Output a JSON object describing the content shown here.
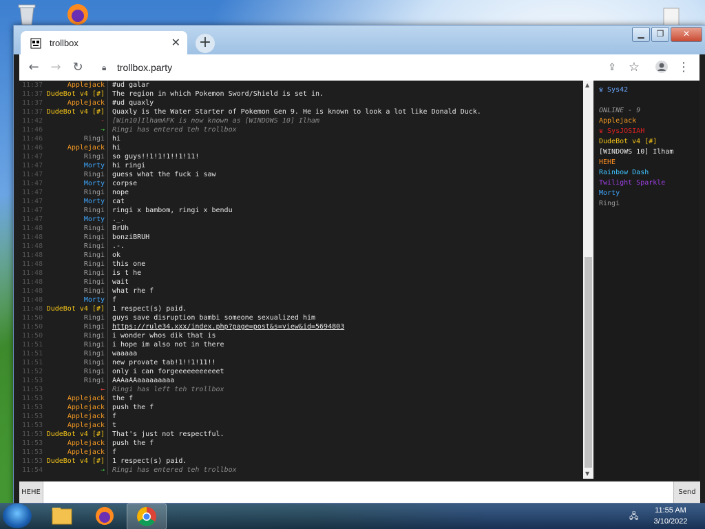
{
  "browser": {
    "tab_title": "trollbox",
    "url": "trollbox.party",
    "new_tab_label": "+",
    "close_tab_label": "✕"
  },
  "chat": {
    "messages": [
      {
        "time": "11:37",
        "nick": "Applejack",
        "color": "#f59a23",
        "text": "#ud galar"
      },
      {
        "time": "11:37",
        "nick": "DudeBot v4 [#]",
        "color": "#f5c518",
        "text": "The region in which Pokemon Sword/Shield is set in."
      },
      {
        "time": "11:37",
        "nick": "Applejack",
        "color": "#f59a23",
        "text": "#ud quaxly"
      },
      {
        "time": "11:37",
        "nick": "DudeBot v4 [#]",
        "color": "#f5c518",
        "text": "Quaxly is the Water Starter of Pokemon Gen 9. He is known to look a lot like Donald Duck."
      },
      {
        "time": "11:42",
        "nick": "-",
        "color": "#e04040",
        "text": "[Win10]IlhamAFK is now known as [WINDOWS 10] Ilham",
        "kind": "rename"
      },
      {
        "time": "11:46",
        "nick": "→",
        "color": "#3ccf3c",
        "text": "Ringi has entered teh trollbox",
        "kind": "sys"
      },
      {
        "time": "11:46",
        "nick": "Ringi",
        "color": "#9a9a9a",
        "text": "hi"
      },
      {
        "time": "11:46",
        "nick": "Applejack",
        "color": "#f59a23",
        "text": "hi"
      },
      {
        "time": "11:47",
        "nick": "Ringi",
        "color": "#9a9a9a",
        "text": "so guys!!1!1!1!!1!11!"
      },
      {
        "time": "11:47",
        "nick": "Morty",
        "color": "#3fa8ff",
        "text": "hi ringi"
      },
      {
        "time": "11:47",
        "nick": "Ringi",
        "color": "#9a9a9a",
        "text": "guess what the fuck i saw"
      },
      {
        "time": "11:47",
        "nick": "Morty",
        "color": "#3fa8ff",
        "text": "corpse"
      },
      {
        "time": "11:47",
        "nick": "Ringi",
        "color": "#9a9a9a",
        "text": "nope"
      },
      {
        "time": "11:47",
        "nick": "Morty",
        "color": "#3fa8ff",
        "text": "cat"
      },
      {
        "time": "11:47",
        "nick": "Ringi",
        "color": "#9a9a9a",
        "text": "ringi x bambom, ringi x bendu"
      },
      {
        "time": "11:47",
        "nick": "Morty",
        "color": "#3fa8ff",
        "text": "._."
      },
      {
        "time": "11:48",
        "nick": "Ringi",
        "color": "#9a9a9a",
        "text": "BrUh"
      },
      {
        "time": "11:48",
        "nick": "Ringi",
        "color": "#9a9a9a",
        "text": "bonziBRUH"
      },
      {
        "time": "11:48",
        "nick": "Ringi",
        "color": "#9a9a9a",
        "text": ".-."
      },
      {
        "time": "11:48",
        "nick": "Ringi",
        "color": "#9a9a9a",
        "text": "ok"
      },
      {
        "time": "11:48",
        "nick": "Ringi",
        "color": "#9a9a9a",
        "text": "this one"
      },
      {
        "time": "11:48",
        "nick": "Ringi",
        "color": "#9a9a9a",
        "text": "is t he"
      },
      {
        "time": "11:48",
        "nick": "Ringi",
        "color": "#9a9a9a",
        "text": "wait"
      },
      {
        "time": "11:48",
        "nick": "Ringi",
        "color": "#9a9a9a",
        "text": "what rhe f"
      },
      {
        "time": "11:48",
        "nick": "Morty",
        "color": "#3fa8ff",
        "text": "f"
      },
      {
        "time": "11:48",
        "nick": "DudeBot v4 [#]",
        "color": "#f5c518",
        "text": "1 respect(s) paid."
      },
      {
        "time": "11:50",
        "nick": "Ringi",
        "color": "#9a9a9a",
        "text": "guys save disruption bambi someone sexualized him"
      },
      {
        "time": "11:50",
        "nick": "Ringi",
        "color": "#9a9a9a",
        "text": "https://rule34.xxx/index.php?page=post&s=view&id=5694803",
        "kind": "link"
      },
      {
        "time": "11:50",
        "nick": "Ringi",
        "color": "#9a9a9a",
        "text": "i wonder whos dik that is"
      },
      {
        "time": "11:51",
        "nick": "Ringi",
        "color": "#9a9a9a",
        "text": "i hope im also not in there"
      },
      {
        "time": "11:51",
        "nick": "Ringi",
        "color": "#9a9a9a",
        "text": "waaaaa"
      },
      {
        "time": "11:51",
        "nick": "Ringi",
        "color": "#9a9a9a",
        "text": "new provate tab!1!!1!11!!"
      },
      {
        "time": "11:52",
        "nick": "Ringi",
        "color": "#9a9a9a",
        "text": "only i can forgeeeeeeeeeeet"
      },
      {
        "time": "11:53",
        "nick": "Ringi",
        "color": "#9a9a9a",
        "text": "AAAaAAaaaaaaaaa"
      },
      {
        "time": "11:53",
        "nick": "←",
        "color": "#e04040",
        "text": "Ringi has left teh trollbox",
        "kind": "sys"
      },
      {
        "time": "11:53",
        "nick": "Applejack",
        "color": "#f59a23",
        "text": "the f"
      },
      {
        "time": "11:53",
        "nick": "Applejack",
        "color": "#f59a23",
        "text": "push the f"
      },
      {
        "time": "11:53",
        "nick": "Applejack",
        "color": "#f59a23",
        "text": "f"
      },
      {
        "time": "11:53",
        "nick": "Applejack",
        "color": "#f59a23",
        "text": "t"
      },
      {
        "time": "11:53",
        "nick": "DudeBot v4 [#]",
        "color": "#f5c518",
        "text": "That's just not respectful."
      },
      {
        "time": "11:53",
        "nick": "Applejack",
        "color": "#f59a23",
        "text": "push the f"
      },
      {
        "time": "11:53",
        "nick": "Applejack",
        "color": "#f59a23",
        "text": "f"
      },
      {
        "time": "11:53",
        "nick": "DudeBot v4 [#]",
        "color": "#f5c518",
        "text": "1 respect(s) paid."
      },
      {
        "time": "11:54",
        "nick": "→",
        "color": "#3ccf3c",
        "text": "Ringi has entered teh trollbox",
        "kind": "sys"
      }
    ]
  },
  "users": {
    "me": "♛ Sys42",
    "online_label": "ONLINE - 9",
    "list": [
      {
        "name": "Applejack",
        "color": "#f59a23"
      },
      {
        "name": "♛ SysJOSIAH",
        "color": "#e02020"
      },
      {
        "name": "DudeBot v4 [#]",
        "color": "#f5c518"
      },
      {
        "name": "[WINDOWS 10] Ilham",
        "color": "#e8e8e8"
      },
      {
        "name": "HEHE",
        "color": "#f58a1f"
      },
      {
        "name": "Rainbow Dash",
        "color": "#3fc3ff"
      },
      {
        "name": "Twilight Sparkle",
        "color": "#9b3fe0"
      },
      {
        "name": "Morty",
        "color": "#3fa8ff"
      },
      {
        "name": "Ringi",
        "color": "#9a9a9a"
      }
    ]
  },
  "input": {
    "nick_button": "HEHE",
    "placeholder": "",
    "send_label": "Send"
  },
  "taskbar": {
    "time": "11:55 AM",
    "date": "3/10/2022"
  }
}
